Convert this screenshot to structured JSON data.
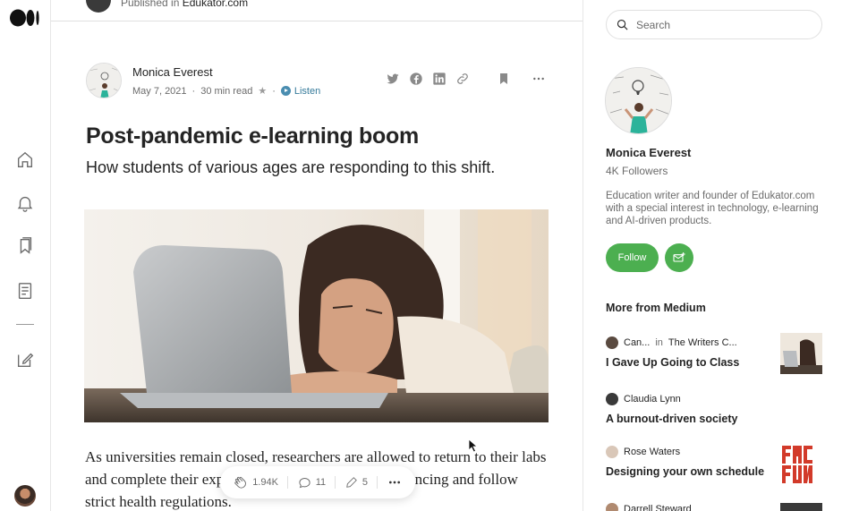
{
  "publication": {
    "prefix": "Published in",
    "name": "Edukator.com"
  },
  "article": {
    "author": "Monica Everest",
    "date": "May 7, 2021",
    "read_time": "30 min read",
    "star": "★",
    "listen": "Listen",
    "title": "Post-pandemic e-learning boom",
    "subtitle": "How students of various ages are responding to this shift.",
    "body": "As universities remain closed, researchers are allowed to return to their labs and complete their experiments under safe social distancing and follow strict health regulations."
  },
  "actions": {
    "claps": "1.94K",
    "comments": "11",
    "edits": "5"
  },
  "search": {
    "placeholder": "Search"
  },
  "sidebar": {
    "name": "Monica Everest",
    "followers": "4K Followers",
    "bio": "Education writer and founder of Edukator.com with a special interest in technology, e-learning and AI-driven products.",
    "follow_label": "Follow",
    "more_title": "More from Medium",
    "recommendations": [
      {
        "author": "Can...",
        "in": "in",
        "publication": "The Writers C...",
        "title": "I Gave Up Going to Class"
      },
      {
        "author": "Claudia Lynn",
        "in": "",
        "publication": "",
        "title": "A burnout-driven society"
      },
      {
        "author": "Rose Waters",
        "in": "",
        "publication": "",
        "title": "Designing your own schedule"
      },
      {
        "author": "Darrell Steward",
        "in": "",
        "publication": "",
        "title": ""
      }
    ]
  },
  "colors": {
    "accent": "#4caf50",
    "listen": "#357a9a",
    "text": "#242424",
    "muted": "#6b6b6b"
  }
}
